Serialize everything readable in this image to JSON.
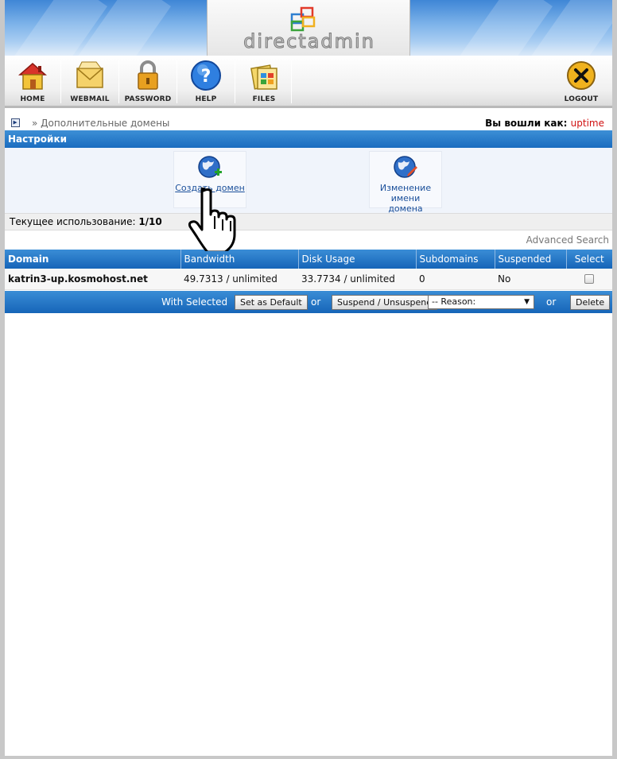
{
  "brand": {
    "name": "directadmin"
  },
  "toolbar": {
    "items": [
      {
        "label": "HOME",
        "icon": "home-icon"
      },
      {
        "label": "WEBMAIL",
        "icon": "webmail-icon"
      },
      {
        "label": "PASSWORD",
        "icon": "password-icon"
      },
      {
        "label": "HELP",
        "icon": "help-icon"
      },
      {
        "label": "FILES",
        "icon": "files-icon"
      }
    ],
    "logout": {
      "label": "LOGOUT",
      "icon": "logout-icon"
    }
  },
  "breadcrumb": {
    "text": "» Дополнительные домены"
  },
  "session": {
    "label": "Вы вошли как:",
    "user": "uptime"
  },
  "settings": {
    "title": "Настройки",
    "create_domain": "Создать домен",
    "rename_domain_line1": "Изменение имени",
    "rename_domain_line2": "домена"
  },
  "usage": {
    "label": "Текущее использование:",
    "value": "1/10"
  },
  "advanced_search": "Advanced Search",
  "table": {
    "headers": [
      "Domain",
      "Bandwidth",
      "Disk Usage",
      "Subdomains",
      "Suspended",
      "Select"
    ],
    "rows": [
      {
        "domain": "katrin3-up.kosmohost.net",
        "bandwidth": "49.7313 / unlimited",
        "disk": "33.7734 / unlimited",
        "subdomains": "0",
        "suspended": "No"
      }
    ]
  },
  "bulk": {
    "with_selected": "With Selected",
    "set_default": "Set as Default",
    "or1": "or",
    "suspend": "Suspend / Unsuspend",
    "reason": "-- Reason:",
    "or2": "or",
    "delete": "Delete"
  },
  "colors": {
    "accent": "#1a6cc0",
    "user": "#d01010",
    "link": "#1a4f9a"
  }
}
